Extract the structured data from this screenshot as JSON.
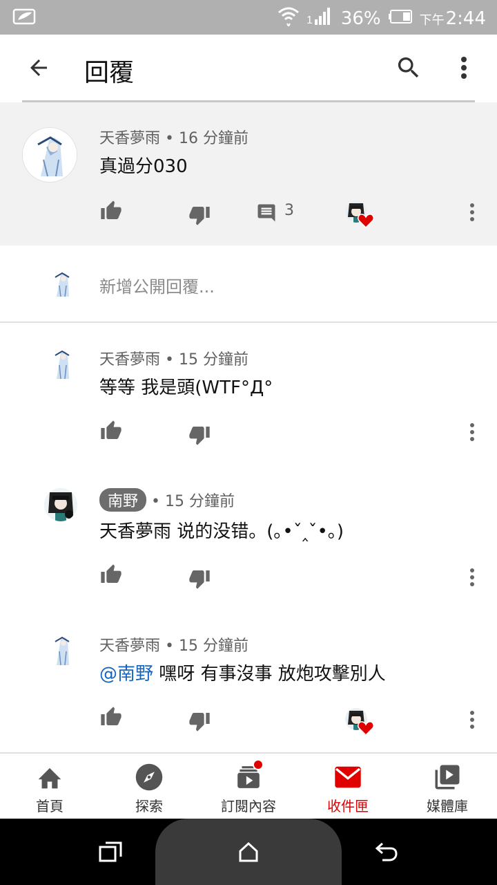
{
  "status_bar": {
    "battery": "36%",
    "time_prefix": "下午",
    "time": "2:44",
    "signal_label": "1"
  },
  "app_bar": {
    "title": "回覆",
    "back_icon": "arrow-back-icon",
    "search_icon": "search-icon",
    "more_icon": "more-vert-icon"
  },
  "parent_comment": {
    "author": "天香夢雨",
    "time": "16 分鐘前",
    "text": "真過分030",
    "reply_count": "3",
    "hearted": true
  },
  "reply_input": {
    "placeholder": "新增公開回覆..."
  },
  "replies": [
    {
      "author": "天香夢雨",
      "time": "15 分鐘前",
      "text": "等等 我是頭(WTF°Д°",
      "author_chip": false,
      "mention": "",
      "hearted": false
    },
    {
      "author": "南野",
      "time": "15 分鐘前",
      "text": "天香夢雨 说的没错。(｡•ˇ‸ˇ•｡)",
      "author_chip": true,
      "mention": "",
      "hearted": false
    },
    {
      "author": "天香夢雨",
      "time": "15 分鐘前",
      "text": "嘿呀 有事沒事 放炮攻擊別人",
      "author_chip": false,
      "mention": "@南野",
      "hearted": true
    }
  ],
  "bottom_nav": {
    "items": [
      {
        "label": "首頁",
        "icon": "home-icon"
      },
      {
        "label": "探索",
        "icon": "explore-icon"
      },
      {
        "label": "訂閱內容",
        "icon": "subscriptions-icon",
        "badge": true
      },
      {
        "label": "收件匣",
        "icon": "inbox-icon",
        "active": true
      },
      {
        "label": "媒體庫",
        "icon": "library-icon"
      }
    ]
  },
  "colors": {
    "accent_red": "#e00000",
    "mention_blue": "#1565c0",
    "status_bar": "#b0b0b0",
    "highlight_bg": "#f2f2f2"
  }
}
